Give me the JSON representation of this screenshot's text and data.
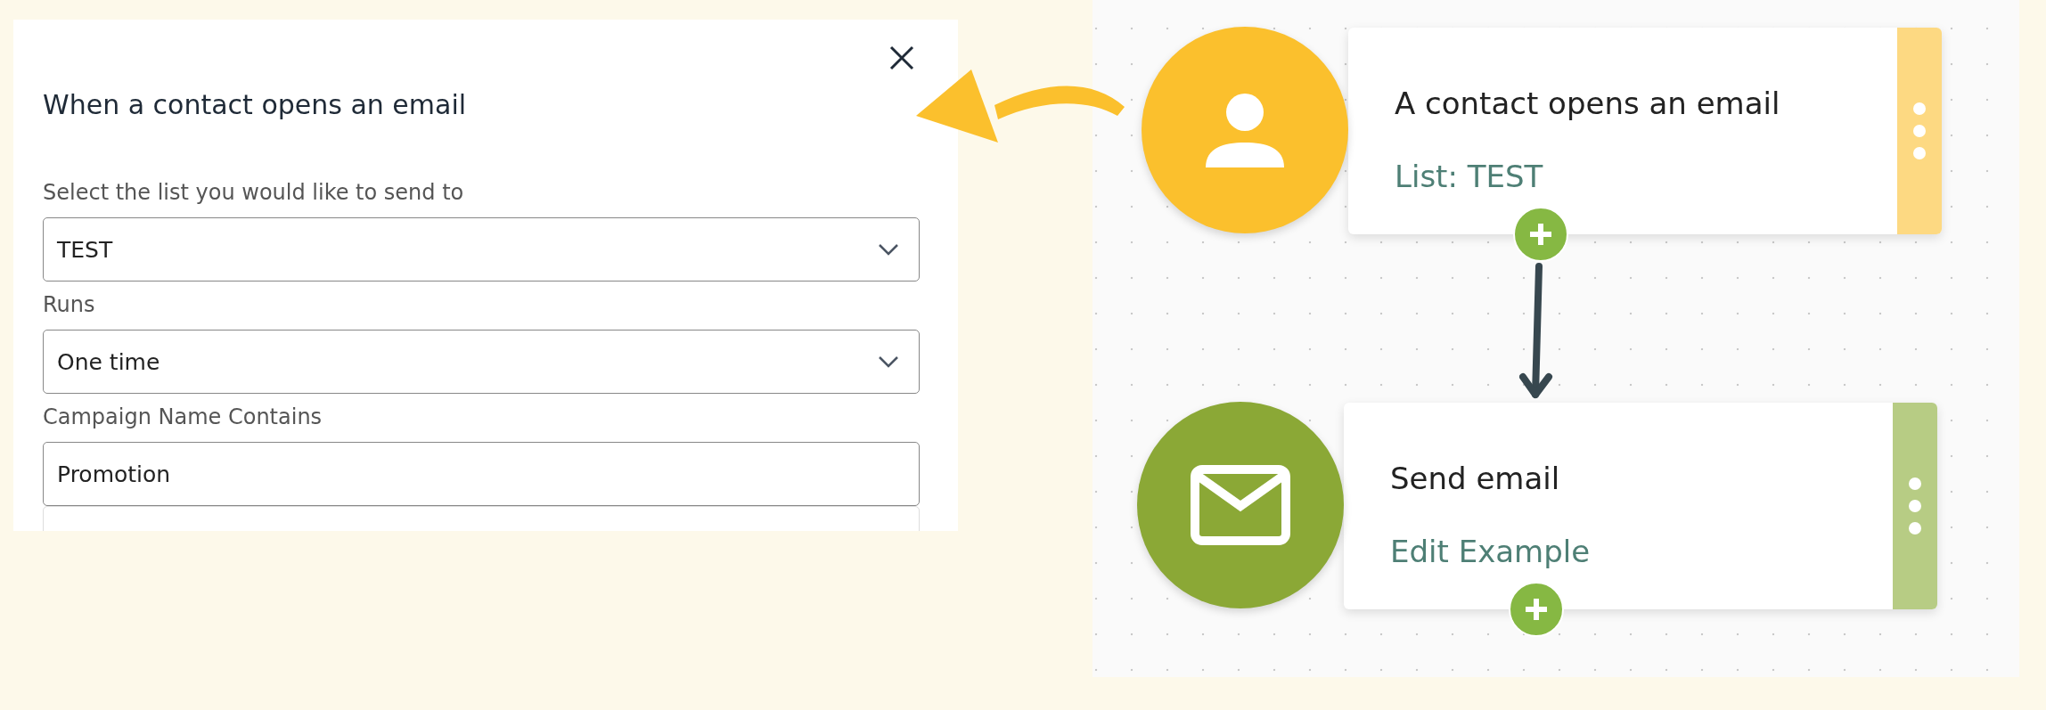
{
  "panel": {
    "title": "When a contact opens an email",
    "fields": [
      {
        "label": "Select the list you would like to send to",
        "value": "TEST",
        "kind": "select"
      },
      {
        "label": "Runs",
        "value": "One time",
        "kind": "select"
      },
      {
        "label": "Campaign Name Contains",
        "value": "Promotion",
        "kind": "text"
      }
    ]
  },
  "workflow": {
    "nodes": [
      {
        "kind": "contact",
        "title": "A contact opens an email",
        "subtitle": "List: TEST",
        "color": "#fbc02d"
      },
      {
        "kind": "email",
        "title": "Send email",
        "subtitle": "Edit Example",
        "color": "#8ba836"
      }
    ]
  }
}
